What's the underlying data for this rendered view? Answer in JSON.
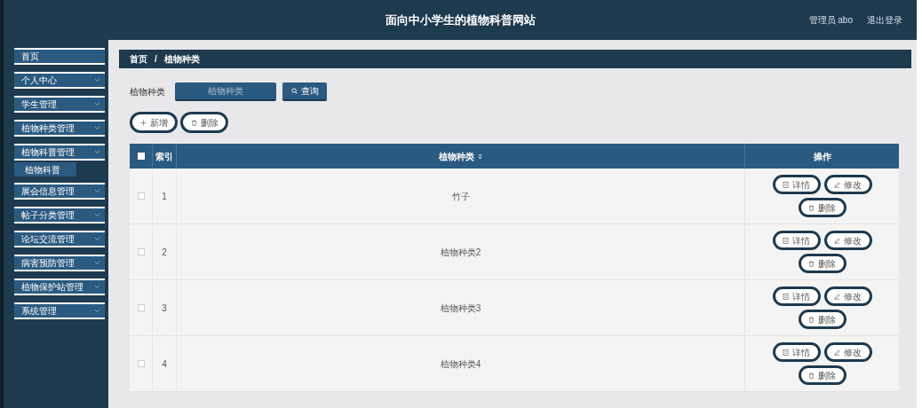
{
  "header": {
    "title": "面向中小学生的植物科普网站",
    "user": "管理员 abo",
    "logout": "退出登录"
  },
  "sidebar": {
    "items": [
      {
        "label": "首页",
        "expandable": false,
        "selected": false
      },
      {
        "label": "个人中心",
        "expandable": true,
        "selected": false
      },
      {
        "label": "学生管理",
        "expandable": true,
        "selected": false
      },
      {
        "label": "植物种类管理",
        "expandable": true,
        "selected": false
      },
      {
        "label": "植物科普管理",
        "expandable": true,
        "selected": false,
        "children": [
          {
            "label": "植物科普",
            "selected": true
          }
        ]
      },
      {
        "label": "展会信息管理",
        "expandable": true,
        "selected": false
      },
      {
        "label": "帖子分类管理",
        "expandable": true,
        "selected": false
      },
      {
        "label": "论坛交流管理",
        "expandable": true,
        "selected": false
      },
      {
        "label": "病害预防管理",
        "expandable": true,
        "selected": false
      },
      {
        "label": "植物保护站管理",
        "expandable": true,
        "selected": false
      },
      {
        "label": "系统管理",
        "expandable": true,
        "selected": false
      }
    ]
  },
  "breadcrumb": {
    "items": [
      "首页",
      "植物种类"
    ],
    "separator": "/"
  },
  "search": {
    "label": "植物种类",
    "placeholder": "植物种类",
    "button": "查询"
  },
  "toolbar": {
    "add": "新增",
    "delete": "删除"
  },
  "table": {
    "columns": [
      "索引",
      "植物种类",
      "操作"
    ],
    "all_checked": false,
    "rows": [
      {
        "checked": false,
        "index": "1",
        "name": "竹子",
        "actions": [
          "详情",
          "修改",
          "删除"
        ]
      },
      {
        "checked": false,
        "index": "2",
        "name": "植物种类2",
        "actions": [
          "详情",
          "修改",
          "删除"
        ]
      },
      {
        "checked": false,
        "index": "3",
        "name": "植物种类3",
        "actions": [
          "详情",
          "修改",
          "删除"
        ]
      },
      {
        "checked": false,
        "index": "4",
        "name": "植物种类4",
        "actions": [
          "详情",
          "修改",
          "删除"
        ]
      }
    ]
  }
}
